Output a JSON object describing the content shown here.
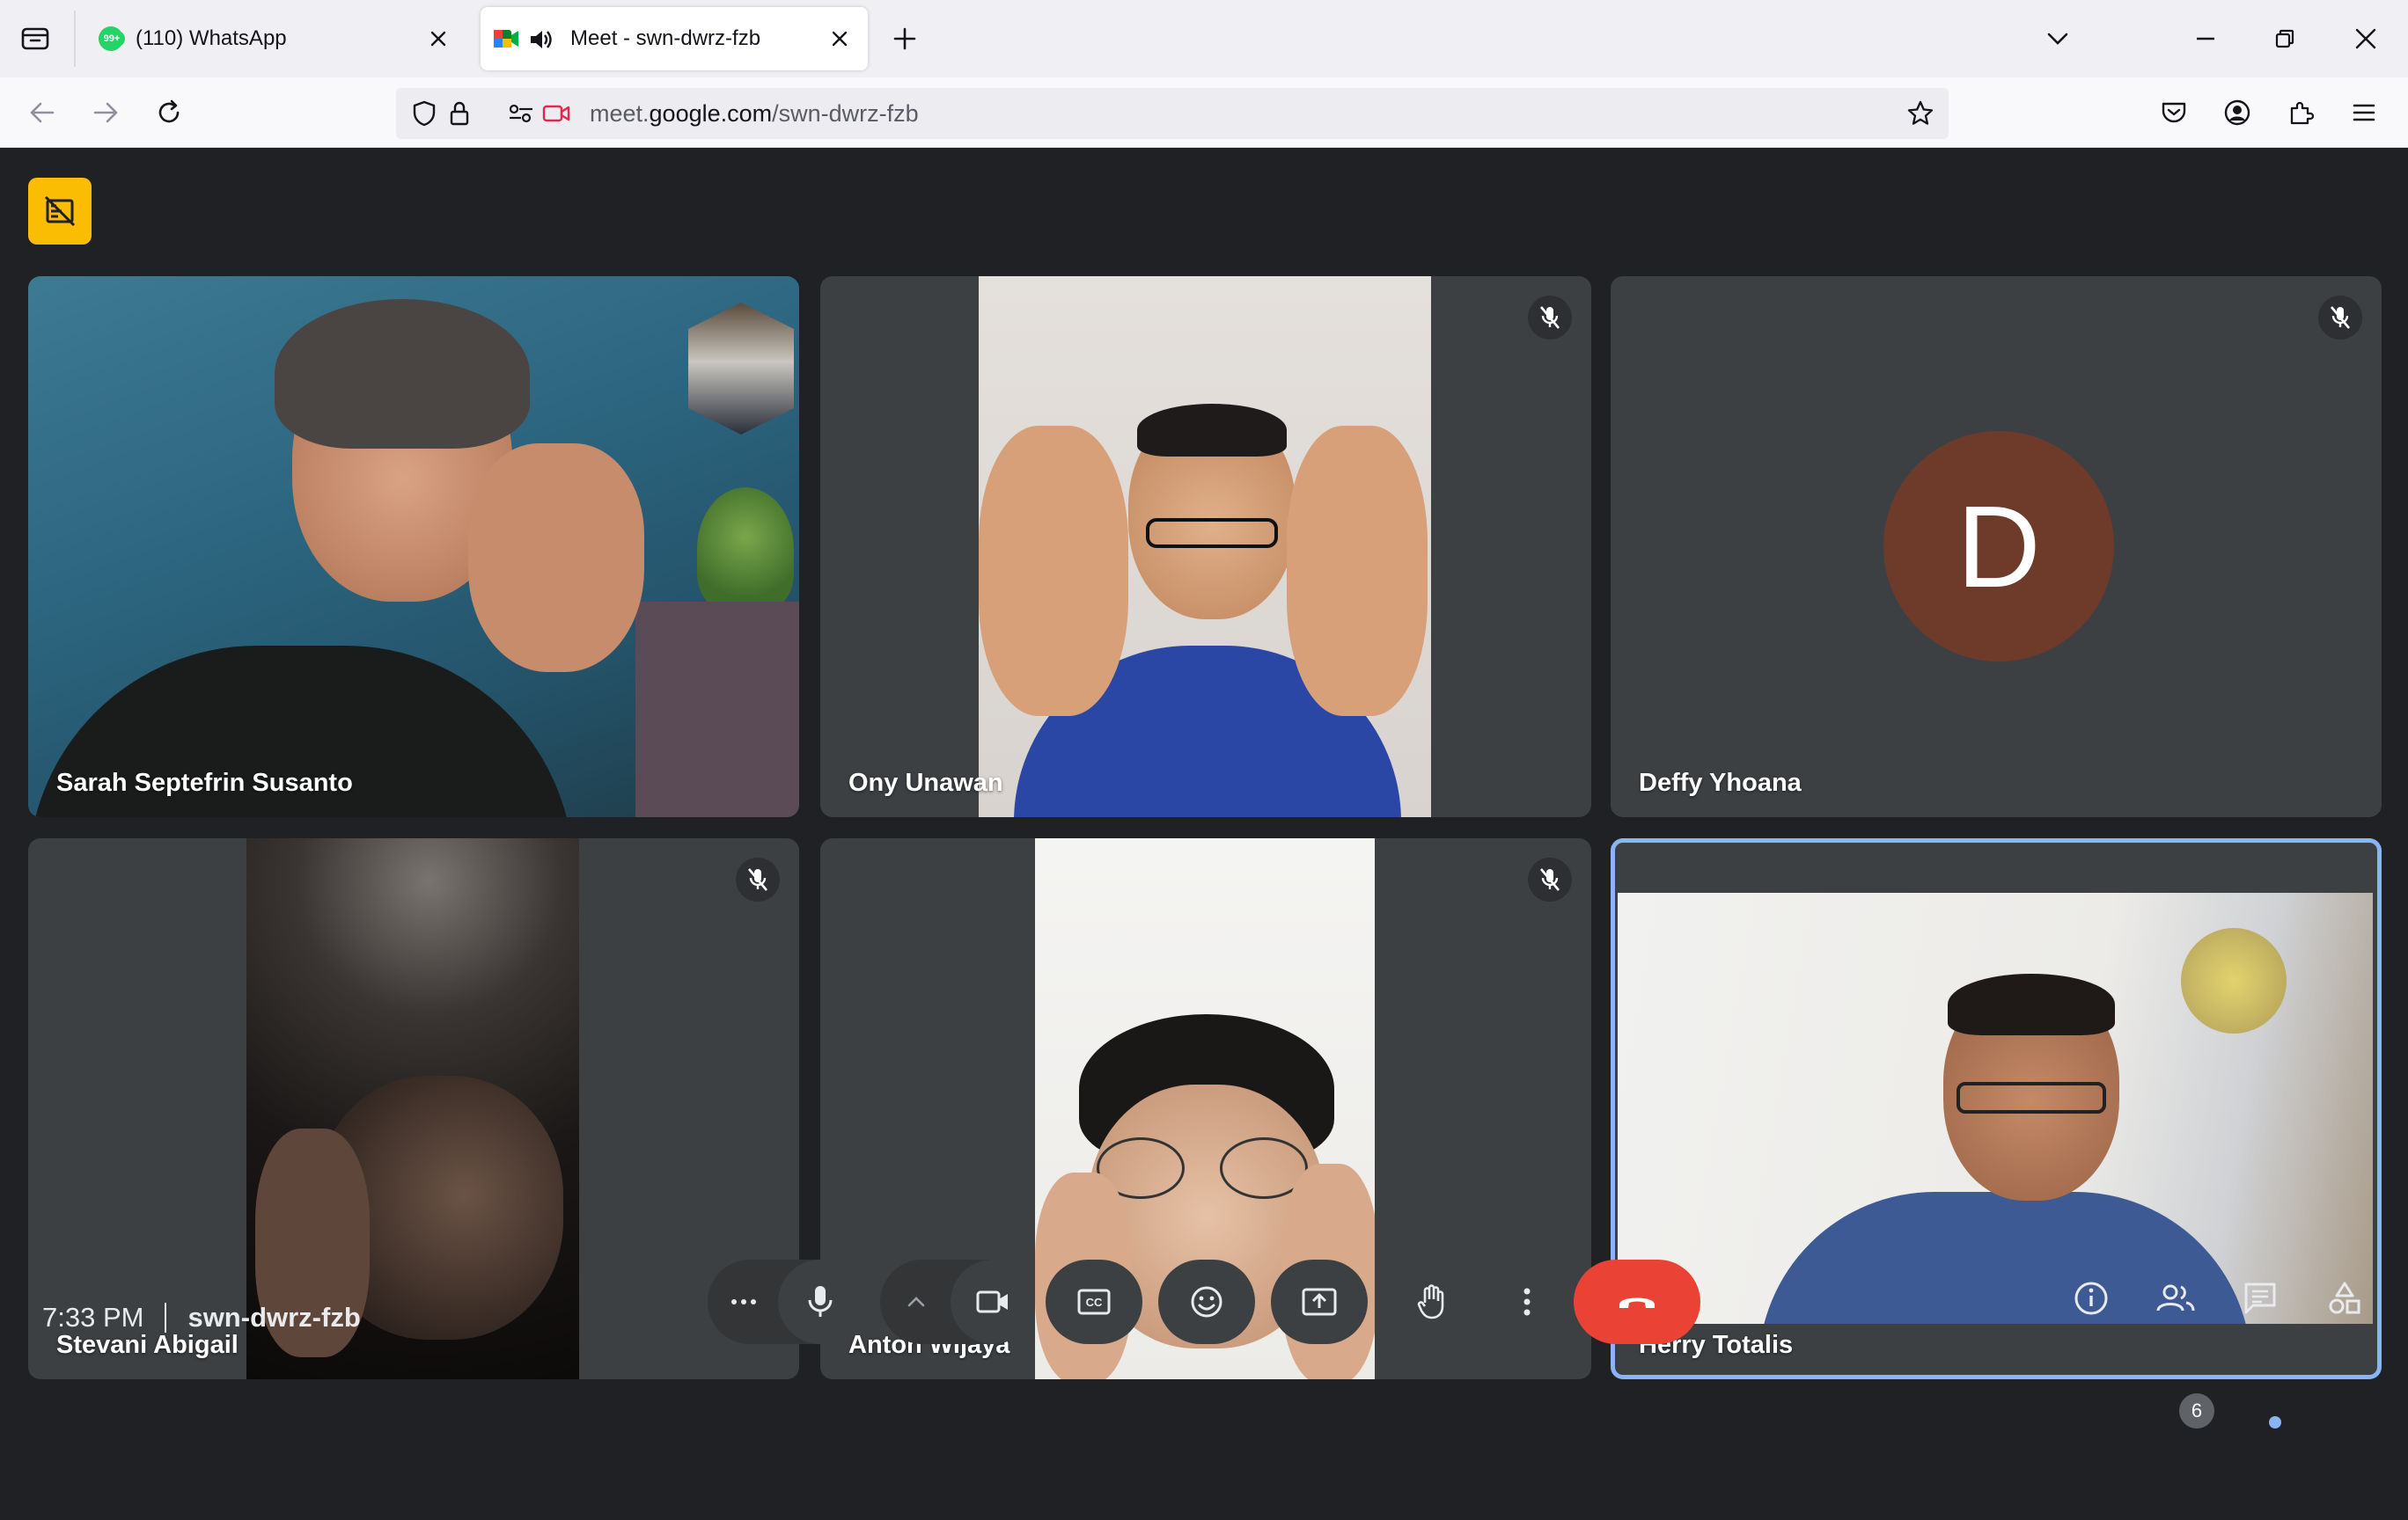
{
  "browser": {
    "tabs": [
      {
        "title": "(110) WhatsApp",
        "badge": "99+",
        "favicon": "whatsapp-icon",
        "active": false
      },
      {
        "title": "Meet - swn-dwrz-fzb",
        "favicon": "google-meet-icon",
        "audio": "speaker-icon",
        "active": true
      }
    ],
    "url": {
      "prefix": "meet.",
      "host": "google.com",
      "path": "/swn-dwrz-fzb"
    },
    "accent": "#0060df"
  },
  "meet": {
    "participants": [
      {
        "name": "Sarah Septefrin Susanto",
        "muted": false,
        "video": true
      },
      {
        "name": "Ony Unawan",
        "muted": true,
        "video": true
      },
      {
        "name": "Deffy Yhoana",
        "muted": true,
        "video": false,
        "avatar_letter": "D",
        "avatar_color": "#6e3b2b"
      },
      {
        "name": "Stevani Abigail",
        "muted": true,
        "video": true
      },
      {
        "name": "Anton Wijaya",
        "muted": true,
        "video": true
      },
      {
        "name": "Herry Totalis",
        "muted": false,
        "video": true,
        "speaking": true
      }
    ],
    "bottom_bar": {
      "time": "7:33 PM",
      "meeting_code": "swn-dwrz-fzb",
      "people_count": "6",
      "end_call_color": "#ea4335",
      "speaking_color": "#8ab4f8"
    }
  }
}
